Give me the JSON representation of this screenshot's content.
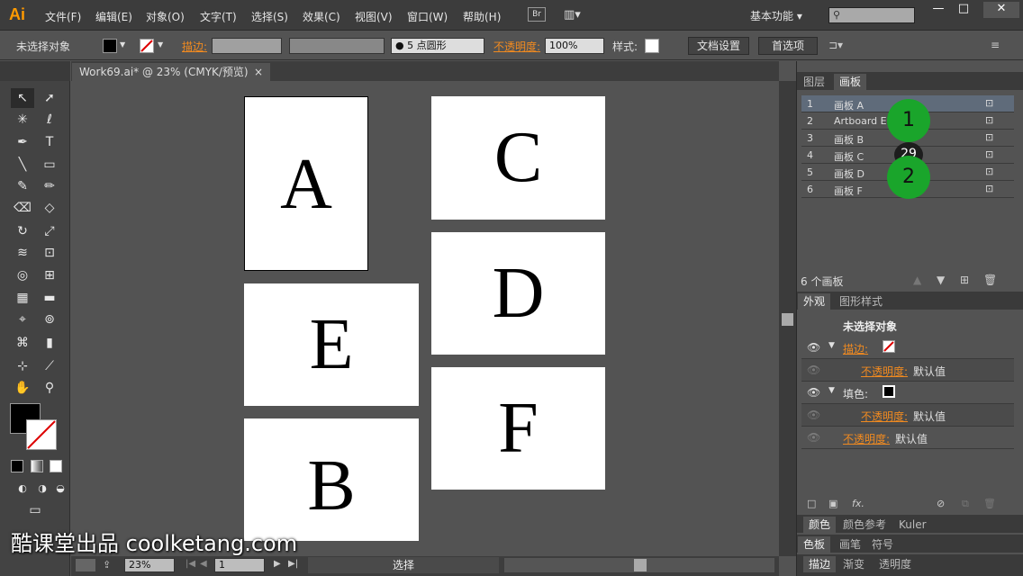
{
  "app": {
    "logo": "Ai",
    "workspace": "基本功能 ▾"
  },
  "menu": [
    "文件(F)",
    "编辑(E)",
    "对象(O)",
    "文字(T)",
    "选择(S)",
    "效果(C)",
    "视图(V)",
    "窗口(W)",
    "帮助(H)"
  ],
  "toolbar_icons": {
    "bridge": "Br",
    "arrange": "▥▾"
  },
  "window_controls": [
    "—",
    "□",
    "✕"
  ],
  "control": {
    "selection": "未选择对象",
    "stroke_label": "描边:",
    "brush": "● 5 点圆形",
    "opacity_label": "不透明度:",
    "opacity_value": "100%",
    "style_label": "样式:",
    "doc_setup": "文档设置",
    "preferences": "首选项"
  },
  "document": {
    "tab_title": "Work69.ai* @ 23% (CMYK/预览)",
    "close": "×"
  },
  "artboards": [
    {
      "label": "A"
    },
    {
      "label": "C"
    },
    {
      "label": "E"
    },
    {
      "label": "D"
    },
    {
      "label": "F"
    },
    {
      "label": "B"
    }
  ],
  "status": {
    "zoom": "23%",
    "page": "1",
    "tool": "选择"
  },
  "watermark": "酷课堂出品 coolketang.com",
  "layers_panel": {
    "tabs": [
      "图层",
      "画板"
    ],
    "rows": [
      {
        "num": "1",
        "name": "画板 A"
      },
      {
        "num": "2",
        "name": "Artboard E"
      },
      {
        "num": "3",
        "name": "画板 B"
      },
      {
        "num": "4",
        "name": "画板 C"
      },
      {
        "num": "5",
        "name": "画板 D"
      },
      {
        "num": "6",
        "name": "画板 F"
      }
    ],
    "count": "6 个画板"
  },
  "markers": [
    "1",
    "29",
    "2"
  ],
  "appearance": {
    "tabs": [
      "外观",
      "图形样式"
    ],
    "title": "未选择对象",
    "stroke": "描边:",
    "opacity": "不透明度:",
    "default": "默认值",
    "fill": "填色:",
    "fx": "fx."
  },
  "bottom_panels": [
    [
      "颜色",
      "颜色参考",
      "Kuler"
    ],
    [
      "色板",
      "画笔",
      "符号"
    ],
    [
      "描边",
      "渐变",
      "透明度"
    ]
  ],
  "colors": {
    "accent": "#f08a20",
    "marker": "#1aa52b",
    "logo": "#ff9a00"
  }
}
